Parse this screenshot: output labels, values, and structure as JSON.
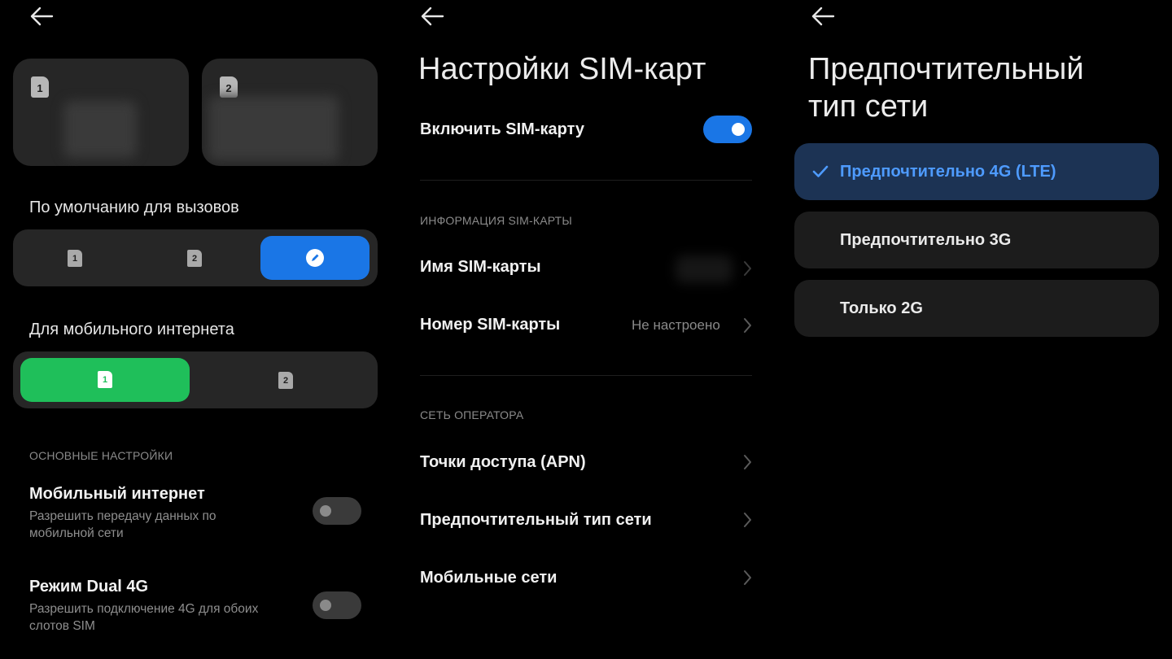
{
  "panel1": {
    "sim_cards": [
      {
        "slot": "1"
      },
      {
        "slot": "2"
      }
    ],
    "calls_default": {
      "label": "По умолчанию для вызовов",
      "options": [
        "1",
        "2",
        "always-ask"
      ],
      "selected": "always-ask"
    },
    "mobile_data": {
      "label": "Для мобильного интернета",
      "options": [
        "1",
        "2"
      ],
      "selected": "1"
    },
    "basic_settings_caption": "ОСНОВНЫЕ НАСТРОЙКИ",
    "mobile_internet": {
      "title": "Мобильный интернет",
      "subtitle_line1": "Разрешить передачу данных по",
      "subtitle_line2": "мобильной сети",
      "enabled": false
    },
    "dual_4g": {
      "title": "Режим Dual 4G",
      "subtitle_line1": "Разрешить подключение 4G для обоих",
      "subtitle_line2": "слотов SIM",
      "enabled": false
    }
  },
  "panel2": {
    "title": "Настройки SIM-карт",
    "enable_sim": {
      "label": "Включить SIM-карту",
      "enabled": true
    },
    "sim_info_caption": "ИНФОРМАЦИЯ SIM-КАРТЫ",
    "sim_name": {
      "label": "Имя SIM-карты"
    },
    "sim_number": {
      "label": "Номер SIM-карты",
      "value": "Не настроено"
    },
    "operator_caption": "СЕТЬ ОПЕРАТОРА",
    "apn": {
      "label": "Точки доступа (APN)"
    },
    "preferred_network": {
      "label": "Предпочтительный тип сети"
    },
    "mobile_networks": {
      "label": "Мобильные сети"
    }
  },
  "panel3": {
    "title_line1": "Предпочтительный",
    "title_line2": "тип сети",
    "options": [
      {
        "label": "Предпочтительно 4G (LTE)",
        "selected": true
      },
      {
        "label": "Предпочтительно 3G",
        "selected": false
      },
      {
        "label": "Только 2G",
        "selected": false
      }
    ]
  },
  "colors": {
    "background": "#000000",
    "card": "#262626",
    "accent_blue": "#1a76e6",
    "accent_green": "#1fbf5a",
    "selected_option_bg": "#1c3354",
    "selected_option_text": "#4e9bff"
  },
  "icons": [
    "back-arrow-icon",
    "sim-card-icon",
    "pencil-icon",
    "chevron-right-icon",
    "checkmark-icon"
  ]
}
